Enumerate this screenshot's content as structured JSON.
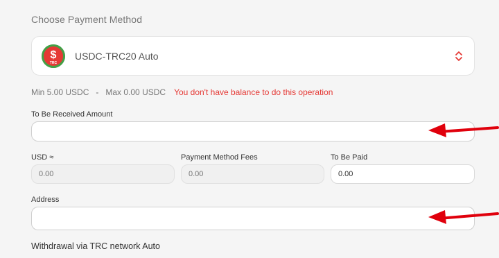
{
  "section_title": "Choose Payment Method",
  "payment_method": {
    "selected": "USDC-TRC20 Auto",
    "icon": "usdc-trc20-coin-icon",
    "icon_badge": "TRC",
    "icon_symbol": "$"
  },
  "limits": {
    "min": "Min 5.00 USDC",
    "separator": "-",
    "max": "Max 0.00 USDC",
    "error": "You don't have balance to do this operation"
  },
  "received_amount": {
    "label": "To Be Received Amount",
    "value": ""
  },
  "usd": {
    "label": "USD ≈",
    "placeholder": "0.00"
  },
  "fees": {
    "label": "Payment Method Fees",
    "placeholder": "0.00"
  },
  "to_be_paid": {
    "label": "To Be Paid",
    "value": "0.00"
  },
  "address": {
    "label": "Address",
    "value": ""
  },
  "footer_note": "Withdrawal via TRC network Auto",
  "colors": {
    "error": "#e53935",
    "coin_ring": "#43a047",
    "coin_center": "#e53935",
    "annotation_arrow": "#e0000c",
    "chevron": "#e53935"
  }
}
